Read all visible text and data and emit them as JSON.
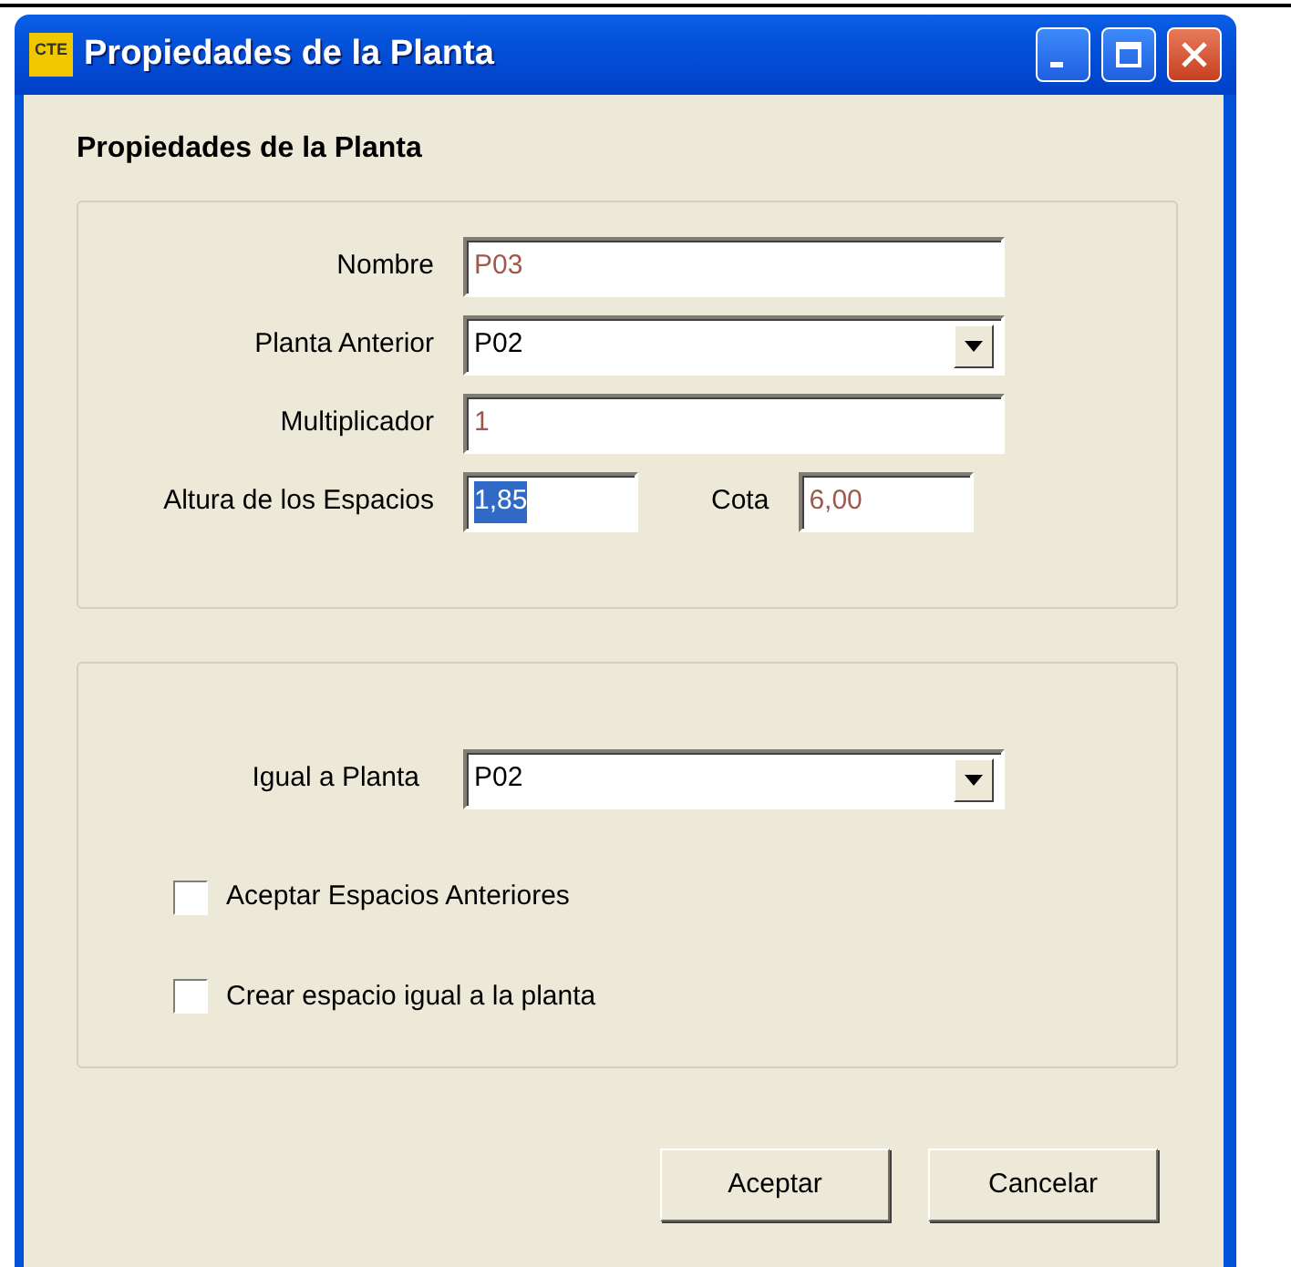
{
  "window": {
    "icon_text": "CTE",
    "title": "Propiedades de la Planta"
  },
  "heading": "Propiedades de la Planta",
  "group_1": {
    "rows": [
      {
        "fields": [
          {
            "label": "Nombre",
            "kind": "text",
            "value": "P03",
            "readonly": true,
            "highlighted": false
          }
        ]
      },
      {
        "fields": [
          {
            "label": "Planta Anterior",
            "kind": "select",
            "value": "P02",
            "readonly": false,
            "highlighted": false
          }
        ]
      },
      {
        "fields": [
          {
            "label": "Multiplicador",
            "kind": "text",
            "value": "1",
            "readonly": true,
            "highlighted": false
          }
        ]
      },
      {
        "fields": [
          {
            "label": "Altura de los Espacios",
            "kind": "text",
            "value": "1,85",
            "readonly": false,
            "highlighted": true
          },
          {
            "label": "Cota",
            "kind": "text",
            "value": "6,00",
            "readonly": true,
            "highlighted": false
          }
        ]
      }
    ]
  },
  "group_2": {
    "field": {
      "label": "Igual a Planta",
      "kind": "select",
      "value": "P02",
      "readonly": false,
      "highlighted": false
    },
    "checkboxes": [
      {
        "label": "Aceptar Espacios Anteriores",
        "checked": false
      },
      {
        "label": "Crear espacio igual a la planta",
        "checked": false
      }
    ]
  },
  "buttons": [
    "Aceptar",
    "Cancelar"
  ]
}
